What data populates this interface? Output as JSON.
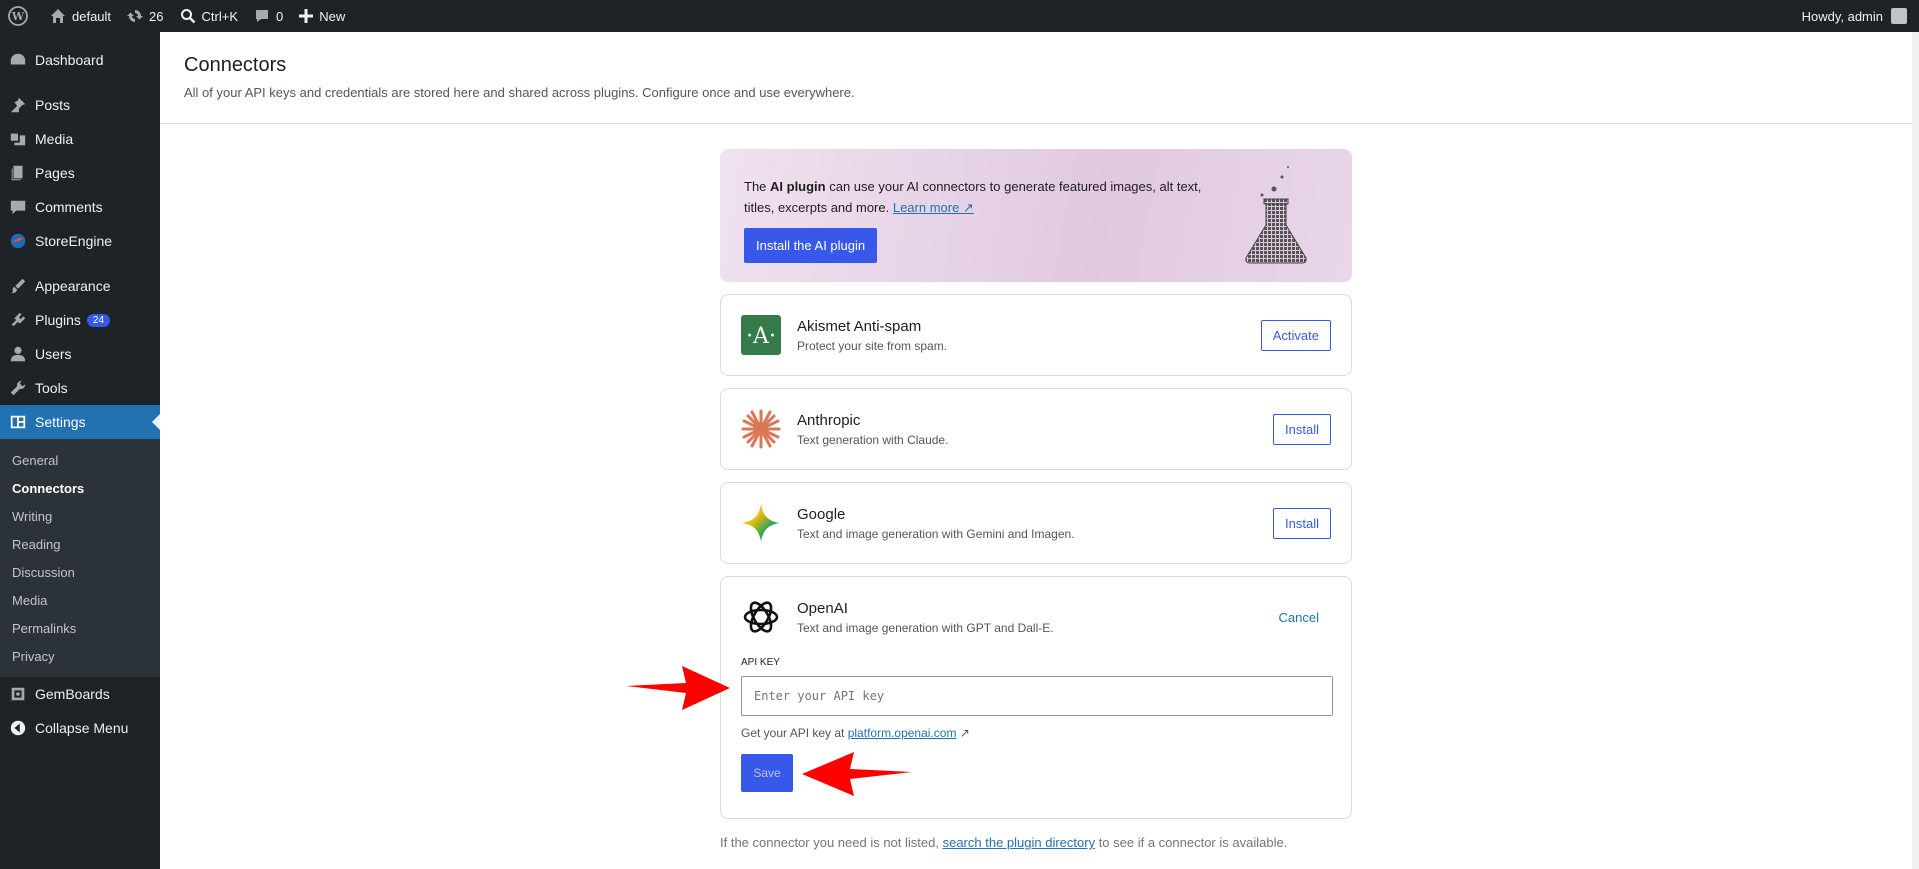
{
  "adminbar": {
    "site_name": "default",
    "updates_count": "26",
    "search_shortcut": "Ctrl+K",
    "comments_count": "0",
    "new_label": "New",
    "greeting": "Howdy, admin"
  },
  "sidebar": {
    "items": [
      {
        "label": "Dashboard",
        "icon": "dashboard-icon"
      },
      {
        "label": "Posts",
        "icon": "pin-icon"
      },
      {
        "label": "Media",
        "icon": "media-icon"
      },
      {
        "label": "Pages",
        "icon": "pages-icon"
      },
      {
        "label": "Comments",
        "icon": "comment-icon"
      },
      {
        "label": "StoreEngine",
        "icon": "storeengine-icon"
      },
      {
        "label": "Appearance",
        "icon": "brush-icon"
      },
      {
        "label": "Plugins",
        "icon": "plugin-icon",
        "badge": "24"
      },
      {
        "label": "Users",
        "icon": "user-icon"
      },
      {
        "label": "Tools",
        "icon": "wrench-icon"
      },
      {
        "label": "Settings",
        "icon": "settings-icon"
      }
    ],
    "submenu": [
      "General",
      "Connectors",
      "Writing",
      "Reading",
      "Discussion",
      "Media",
      "Permalinks",
      "Privacy"
    ],
    "after": [
      {
        "label": "GemBoards",
        "icon": "gemboards-icon"
      },
      {
        "label": "Collapse Menu",
        "icon": "collapse-icon"
      }
    ]
  },
  "page": {
    "title": "Connectors",
    "description": "All of your API keys and credentials are stored here and shared across plugins. Configure once and use everywhere."
  },
  "banner": {
    "text_pre": "The ",
    "text_bold": "AI plugin",
    "text_post": " can use your AI connectors to generate featured images, alt text, titles, excerpts and more. ",
    "learn_more": "Learn more ↗",
    "button": "Install the AI plugin"
  },
  "connectors": [
    {
      "name": "Akismet Anti-spam",
      "desc": "Protect your site from spam.",
      "action": "Activate"
    },
    {
      "name": "Anthropic",
      "desc": "Text generation with Claude.",
      "action": "Install"
    },
    {
      "name": "Google",
      "desc": "Text and image generation with Gemini and Imagen.",
      "action": "Install"
    }
  ],
  "openai": {
    "name": "OpenAI",
    "desc": "Text and image generation with GPT and Dall-E.",
    "cancel": "Cancel",
    "field_label": "API KEY",
    "placeholder": "Enter your API key",
    "help_pre": "Get your API key at ",
    "help_link": "platform.openai.com",
    "help_post": " ↗",
    "save": "Save"
  },
  "footer": {
    "pre": "If the connector you need is not listed, ",
    "link": "search the plugin directory",
    "post": " to see if a connector is available."
  },
  "colors": {
    "accent": "#3858e9",
    "admin_dark": "#1d2327",
    "settings_highlight": "#2271b1",
    "arrow": "#ff0000"
  }
}
